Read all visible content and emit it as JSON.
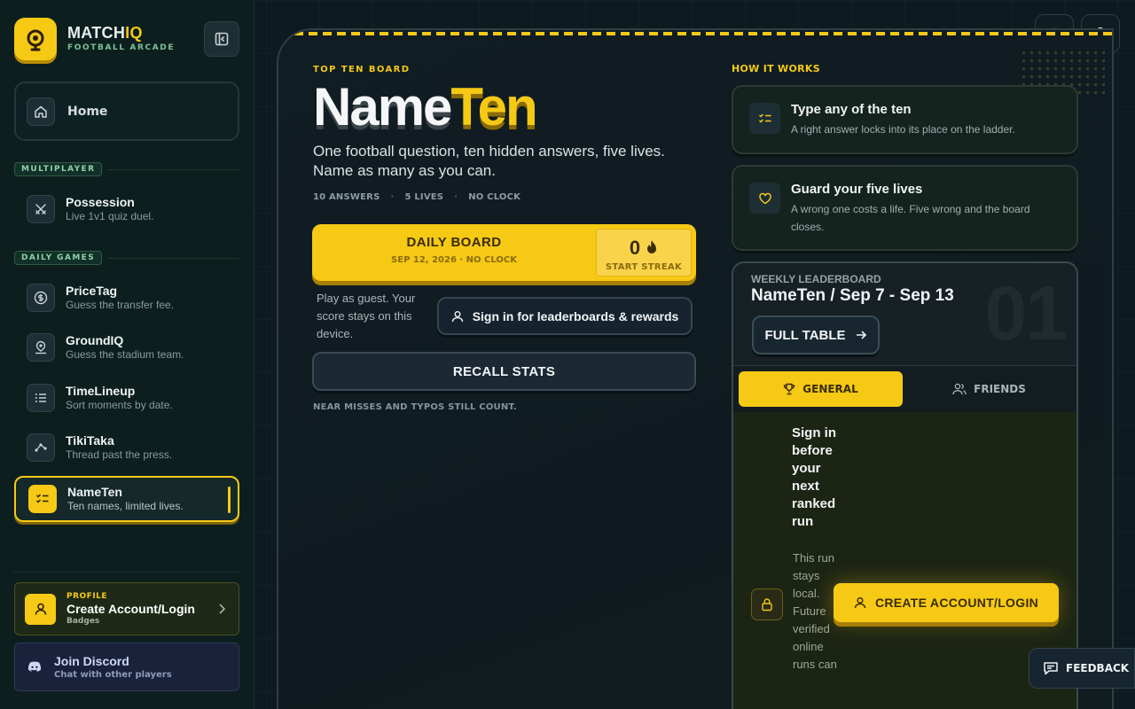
{
  "brand": {
    "name_main": "MATCH",
    "name_accent": "IQ",
    "tagline": "FOOTBALL ARCADE"
  },
  "sidebar": {
    "home_label": "Home",
    "sections": [
      {
        "label": "MULTIPLAYER"
      },
      {
        "label": "DAILY GAMES"
      }
    ],
    "items": [
      {
        "title": "Possession",
        "sub": "Live 1v1 quiz duel."
      },
      {
        "title": "PriceTag",
        "sub": "Guess the transfer fee."
      },
      {
        "title": "GroundIQ",
        "sub": "Guess the stadium team."
      },
      {
        "title": "TimeLineup",
        "sub": "Sort moments by date."
      },
      {
        "title": "TikiTaka",
        "sub": "Thread past the press."
      },
      {
        "title": "NameTen",
        "sub": "Ten names, limited lives.",
        "active": true
      }
    ],
    "profile": {
      "tag": "PROFILE",
      "title": "Create Account/Login",
      "sub": "Badges"
    },
    "discord": {
      "title": "Join Discord",
      "sub": "Chat with other players"
    }
  },
  "main": {
    "eyebrow": "TOP TEN BOARD",
    "hero_part1": "Name",
    "hero_part2": "Ten",
    "tagline": "One football question, ten hidden answers, five lives. Name as many as you can.",
    "meta": [
      "10 ANSWERS",
      "5 LIVES",
      "NO CLOCK"
    ],
    "meta_sep": "·",
    "daily": {
      "title": "DAILY BOARD",
      "date": "SEP 12, 2026 · NO CLOCK",
      "streak_value": "0",
      "streak_label": "START STREAK"
    },
    "guest_note": "Play as guest. Your score stays on this device.",
    "signin_label": "Sign in for leaderboards & rewards",
    "recall_label": "RECALL STATS",
    "footnote": "NEAR MISSES AND TYPOS STILL COUNT."
  },
  "how_it_works": {
    "title": "HOW IT WORKS",
    "cards": [
      {
        "title": "Type any of the ten",
        "text": "A right answer locks into its place on the ladder."
      },
      {
        "title": "Guard your five lives",
        "text": "A wrong one costs a life. Five wrong and the board closes."
      }
    ]
  },
  "leaderboard": {
    "tag": "WEEKLY LEADERBOARD",
    "title": "NameTen / Sep 7 - Sep 13",
    "big_number": "01",
    "full_table": "FULL TABLE",
    "tabs": [
      {
        "label": "GENERAL",
        "active": true
      },
      {
        "label": "FRIENDS",
        "active": false
      }
    ],
    "signin_heading": "Sign in before your next ranked run",
    "signin_text": "This run stays local. Future verified online runs can",
    "create_label": "CREATE ACCOUNT/LOGIN"
  },
  "feedback_label": "FEEDBACK",
  "colors": {
    "accent": "#f6c915",
    "background": "#0d1b20",
    "sidebar": "#0c1f1e"
  }
}
